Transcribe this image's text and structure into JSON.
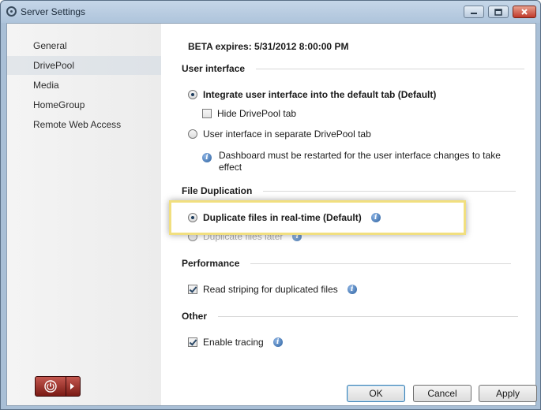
{
  "window": {
    "title": "Server Settings"
  },
  "sidebar": {
    "items": [
      {
        "label": "General",
        "selected": false
      },
      {
        "label": "DrivePool",
        "selected": true
      },
      {
        "label": "Media",
        "selected": false
      },
      {
        "label": "HomeGroup",
        "selected": false
      },
      {
        "label": "Remote Web Access",
        "selected": false
      }
    ]
  },
  "content": {
    "beta_expires": "BETA expires: 5/31/2012 8:00:00 PM",
    "user_interface": {
      "heading": "User interface",
      "integrate_option": "Integrate user interface into the default tab (Default)",
      "hide_tab_label": "Hide DrivePool tab",
      "separate_option": "User interface in separate DrivePool tab",
      "restart_note": "Dashboard must be restarted for the user interface changes to take effect"
    },
    "file_duplication": {
      "heading": "File Duplication",
      "realtime_option": "Duplicate files in real-time (Default)",
      "later_option": "Duplicate files later"
    },
    "performance": {
      "heading": "Performance",
      "read_striping_label": "Read striping for duplicated files"
    },
    "other": {
      "heading": "Other",
      "tracing_label": "Enable tracing"
    }
  },
  "buttons": {
    "ok": "OK",
    "cancel": "Cancel",
    "apply": "Apply"
  },
  "colors": {
    "highlight": "#f1df7f",
    "accent": "#2a5f9e",
    "power": "#8b1e18"
  }
}
